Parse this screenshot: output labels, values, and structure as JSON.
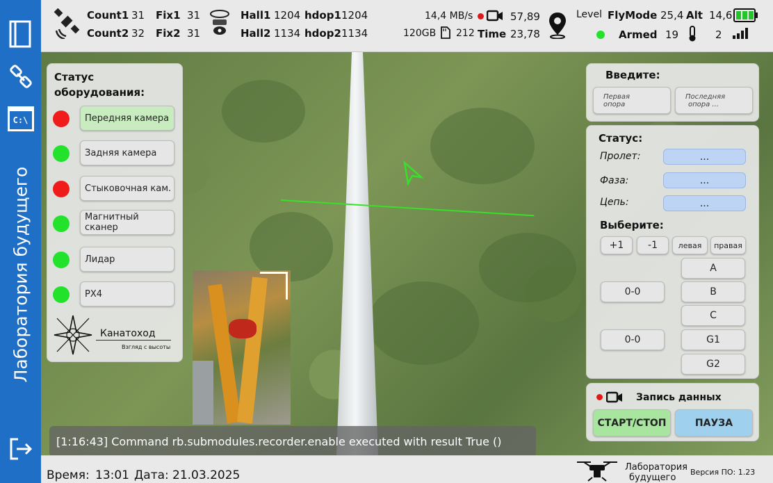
{
  "sidebar": {
    "title": "Лаборатория будущего",
    "icons": [
      "notebook-icon",
      "link-icon",
      "terminal-icon",
      "logout-icon"
    ],
    "terminal_text": "C:\\"
  },
  "topbar": {
    "count1_label": "Count1",
    "count1_value": "31",
    "count2_label": "Count2",
    "count2_value": "32",
    "fix1_label": "Fix1",
    "fix1_value": "31",
    "fix2_label": "Fix2",
    "fix2_value": "31",
    "hall1_label": "Hall1",
    "hall1_value": "1204",
    "hall2_label": "Hall2",
    "hall2_value": "1134",
    "hdop1_label": "hdop1",
    "hdop1_value": "1204",
    "hdop2_label": "hdop2",
    "hdop2_value": "1134",
    "rate": "14,4 MB/s",
    "storage": "120GB",
    "storage_value": "212",
    "rec_value": "57,89",
    "time_label": "Time",
    "time_value": "23,78",
    "level_label": "Level",
    "flymode_label": "FlyMode",
    "flymode_value": "25,4",
    "alt_label": "Alt",
    "alt_value": "14,6",
    "armed_label": "Armed",
    "armed_value": "19",
    "signal_value": "2"
  },
  "equipment": {
    "title": "Статус оборудования:",
    "items": [
      {
        "label": "Передняя камера",
        "status": "red",
        "active": true
      },
      {
        "label": "Задняя камера",
        "status": "green",
        "active": false
      },
      {
        "label": "Стыковочная кам.",
        "status": "red",
        "active": false
      },
      {
        "label": "Магнитный сканер",
        "status": "green",
        "active": false
      },
      {
        "label": "Лидар",
        "status": "green",
        "active": false
      },
      {
        "label": "PX4",
        "status": "green",
        "active": false
      }
    ],
    "logo_text": "Канатоход",
    "logo_sub": "Взгляд с высоты"
  },
  "input_panel": {
    "title": "Введите:",
    "first_line1": "Первая",
    "first_line2": "опора",
    "last_line1": "Последняя",
    "last_line2": "опора ..."
  },
  "status_panel": {
    "title": "Статус:",
    "span_label": "Пролет:",
    "span_value": "...",
    "phase_label": "Фаза:",
    "phase_value": "...",
    "chain_label": "Цепь:",
    "chain_value": "...",
    "select_title": "Выберите:",
    "plus1": "+1",
    "minus1": "-1",
    "left": "левая",
    "right": "правая",
    "counter1": "0-0",
    "counter2": "0-0",
    "phases": [
      "A",
      "B",
      "C",
      "G1",
      "G2"
    ]
  },
  "record_panel": {
    "title": "Запись данных",
    "start_stop": "СТАРТ/СТОП",
    "pause": "ПАУЗА"
  },
  "console": {
    "message": "[1:16:43] Command rb.submodules.recorder.enable executed with result True ()"
  },
  "bottombar": {
    "time_label": "Время:",
    "time_value": "13:01",
    "date_label": "Дата:",
    "date_value": "21.03.2025",
    "brand_line1": "Лаборатория",
    "brand_line2": "будущего",
    "version": "Версия ПО: 1.23"
  },
  "colors": {
    "sidebar": "#1f6fc6",
    "start": "#a8e6a0",
    "pause": "#9fd0ee",
    "field": "#bdd4f5",
    "status_red": "#f01c1c",
    "status_green": "#23e22b",
    "horizon": "#38e02a"
  }
}
